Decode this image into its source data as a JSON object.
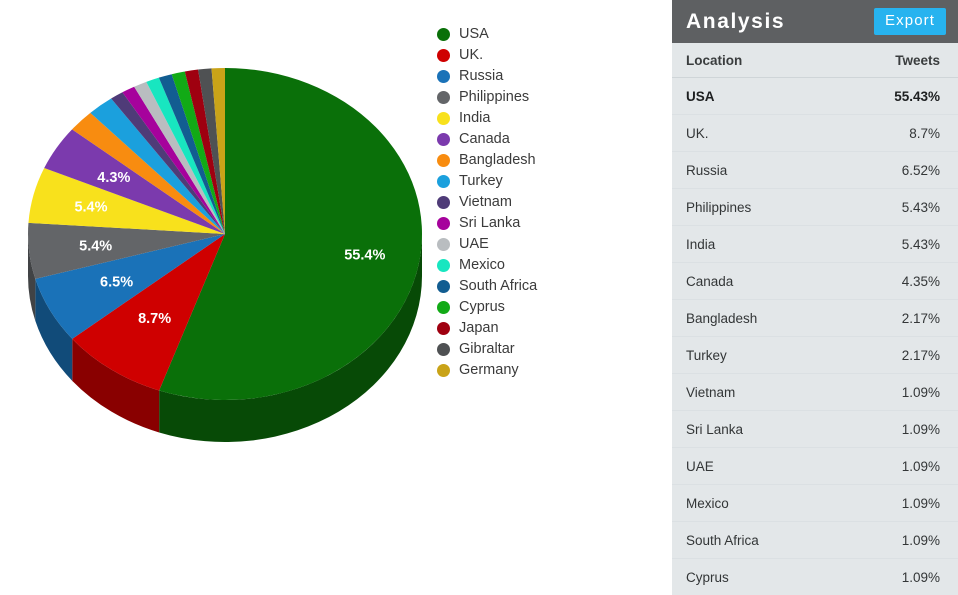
{
  "panel": {
    "title": "Analysis",
    "export_label": "Export",
    "header_bg": "#5e6062",
    "export_bg": "#27b3ef",
    "body_bg": "#e3e7e9",
    "columns": {
      "location": "Location",
      "tweets": "Tweets"
    },
    "rows": [
      {
        "location": "USA",
        "tweets": "55.43%",
        "emphasis": true
      },
      {
        "location": "UK.",
        "tweets": "8.7%",
        "emphasis": false
      },
      {
        "location": "Russia",
        "tweets": "6.52%",
        "emphasis": false
      },
      {
        "location": "Philippines",
        "tweets": "5.43%",
        "emphasis": false
      },
      {
        "location": "India",
        "tweets": "5.43%",
        "emphasis": false
      },
      {
        "location": "Canada",
        "tweets": "4.35%",
        "emphasis": false
      },
      {
        "location": "Bangladesh",
        "tweets": "2.17%",
        "emphasis": false
      },
      {
        "location": "Turkey",
        "tweets": "2.17%",
        "emphasis": false
      },
      {
        "location": "Vietnam",
        "tweets": "1.09%",
        "emphasis": false
      },
      {
        "location": "Sri Lanka",
        "tweets": "1.09%",
        "emphasis": false
      },
      {
        "location": "UAE",
        "tweets": "1.09%",
        "emphasis": false
      },
      {
        "location": "Mexico",
        "tweets": "1.09%",
        "emphasis": false
      },
      {
        "location": "South Africa",
        "tweets": "1.09%",
        "emphasis": false
      },
      {
        "location": "Cyprus",
        "tweets": "1.09%",
        "emphasis": false
      }
    ]
  },
  "chart_data": {
    "type": "pie",
    "title": "",
    "legend_position": "right",
    "three_d": true,
    "start_angle_deg": 0,
    "direction": "clockwise",
    "categories": [
      "USA",
      "UK.",
      "Russia",
      "Philippines",
      "India",
      "Canada",
      "Bangladesh",
      "Turkey",
      "Vietnam",
      "Sri Lanka",
      "UAE",
      "Mexico",
      "South Africa",
      "Cyprus",
      "Japan",
      "Gibraltar",
      "Germany"
    ],
    "values": [
      55.43,
      8.7,
      6.52,
      5.43,
      5.43,
      4.35,
      2.17,
      2.17,
      1.09,
      1.09,
      1.09,
      1.09,
      1.09,
      1.09,
      1.09,
      1.09,
      1.09
    ],
    "colors": [
      "#0a7009",
      "#cf0000",
      "#1a72b8",
      "#636568",
      "#f8e11c",
      "#7b3aad",
      "#f88c10",
      "#1ba0dd",
      "#4f3b78",
      "#a6029c",
      "#b9bdc0",
      "#18e6c0",
      "#125d91",
      "#12aa16",
      "#9f0010",
      "#4f5153",
      "#c9a318"
    ],
    "labels_shown": [
      {
        "category": "USA",
        "label": "55.4%"
      },
      {
        "category": "UK.",
        "label": "8.7%"
      },
      {
        "category": "Russia",
        "label": "6.5%"
      },
      {
        "category": "Philippines",
        "label": "5.4%"
      },
      {
        "category": "India",
        "label": "5.4%"
      },
      {
        "category": "Canada",
        "label": "4.3%"
      }
    ]
  },
  "legend": {
    "items": [
      {
        "label": "USA",
        "color": "#0a7009"
      },
      {
        "label": "UK.",
        "color": "#cf0000"
      },
      {
        "label": "Russia",
        "color": "#1a72b8"
      },
      {
        "label": "Philippines",
        "color": "#636568"
      },
      {
        "label": "India",
        "color": "#f8e11c"
      },
      {
        "label": "Canada",
        "color": "#7b3aad"
      },
      {
        "label": "Bangladesh",
        "color": "#f88c10"
      },
      {
        "label": "Turkey",
        "color": "#1ba0dd"
      },
      {
        "label": "Vietnam",
        "color": "#4f3b78"
      },
      {
        "label": "Sri Lanka",
        "color": "#a6029c"
      },
      {
        "label": "UAE",
        "color": "#b9bdc0"
      },
      {
        "label": "Mexico",
        "color": "#18e6c0"
      },
      {
        "label": "South Africa",
        "color": "#125d91"
      },
      {
        "label": "Cyprus",
        "color": "#12aa16"
      },
      {
        "label": "Japan",
        "color": "#9f0010"
      },
      {
        "label": "Gibraltar",
        "color": "#4f5153"
      },
      {
        "label": "Germany",
        "color": "#c9a318"
      }
    ]
  }
}
